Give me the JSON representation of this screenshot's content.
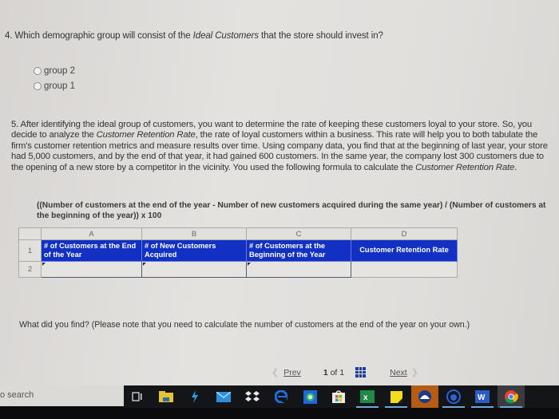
{
  "question4": {
    "number": "4.",
    "text_before": "Which demographic group will consist of the ",
    "emphasis": "Ideal Customers",
    "text_after": " that the store should invest in?",
    "options": [
      {
        "label": "group 2",
        "selected": false
      },
      {
        "label": "group 1",
        "selected": false
      }
    ]
  },
  "question5": {
    "part1": "5. After identifying the ideal group of customers, you want to determine the rate of keeping these customers loyal to your store. So, you decide to analyze the ",
    "emphasis1": "Customer Retention Rate",
    "part2": ", the rate of loyal customers within a business. This rate will help you to both tabulate the firm's customer retention metrics and measure results over time. Using company data, you find that at the beginning of last year, your store had 5,000 customers, and by the end of that year, it had gained 600 customers. In the same year, the company lost 300 customers due to the opening of a new store by a competitor in the vicinity. You used the following formula to calculate the ",
    "emphasis2": "Customer Retention Rate",
    "part3": ".",
    "formula": "((Number of customers at the end of the year - Number of new customers acquired during the same year) / (Number of customers at the beginning of the year)) x 100"
  },
  "spreadsheet": {
    "column_letters": [
      "A",
      "B",
      "C",
      "D"
    ],
    "row_numbers": [
      "1",
      "2"
    ],
    "headers": [
      "# of Customers at the End of the Year",
      "# of New Customers Acquired",
      "# of Customers at the Beginning of the Year",
      "Customer Retention Rate"
    ],
    "row2_values": [
      "",
      "",
      "",
      ""
    ],
    "header_color": "#1231c4"
  },
  "followup": "What did you find? (Please note that you need to calculate the number of customers at the end of the year on your own.)",
  "pager": {
    "prev_label": "Prev",
    "current": "1",
    "of_label": "of",
    "total": "1",
    "next_label": "Next"
  },
  "taskbar": {
    "search_text": "o search",
    "apps": [
      {
        "name": "task-view",
        "underlined": false
      },
      {
        "name": "file-explorer",
        "underlined": false
      },
      {
        "name": "vscode-like",
        "underlined": false
      },
      {
        "name": "mail",
        "underlined": false
      },
      {
        "name": "dropbox",
        "underlined": false
      },
      {
        "name": "edge",
        "underlined": false
      },
      {
        "name": "whatsapp",
        "underlined": false
      },
      {
        "name": "store",
        "underlined": false
      },
      {
        "name": "excel",
        "underlined": true
      },
      {
        "name": "sticky-notes",
        "underlined": true
      },
      {
        "name": "app-active",
        "underlined": false,
        "active": true
      },
      {
        "name": "app-circle",
        "underlined": true
      },
      {
        "name": "word",
        "underlined": true
      },
      {
        "name": "chrome",
        "underlined": true
      }
    ]
  }
}
